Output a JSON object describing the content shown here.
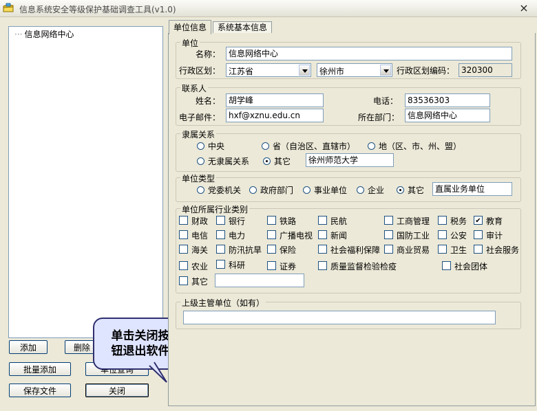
{
  "window": {
    "title": "信息系统安全等级保护基础调查工具(v1.0)",
    "close_symbol": "×"
  },
  "tree": {
    "items": [
      {
        "label": "信息网络中心"
      }
    ]
  },
  "left_buttons": {
    "add": "添加",
    "delete": "删除",
    "batch_add": "批量添加",
    "check": "单位查询",
    "save": "保存文件",
    "close": "关闭"
  },
  "callout": {
    "text": "单击关闭按\n钮退出软件"
  },
  "tabs": [
    {
      "label": "单位信息",
      "active": true
    },
    {
      "label": "系统基本信息",
      "active": false
    }
  ],
  "unit": {
    "title": "单位",
    "name_label": "名称：",
    "name_value": "信息网络中心",
    "region_label": "行政区划：",
    "province": "江苏省",
    "city": "徐州市",
    "code_label": "行政区划编码：",
    "code_value": "320300"
  },
  "contact": {
    "title": "联系人",
    "name_label": "姓名：",
    "name_value": "胡学峰",
    "phone_label": "电话：",
    "phone_value": "83536303",
    "email_label": "电子邮件：",
    "email_value": "hxf@xznu.edu.cn",
    "dept_label": "所在部门：",
    "dept_value": "信息网络中心"
  },
  "affiliation": {
    "title": "隶属关系",
    "options": [
      "中央",
      "省（自治区、直辖市）",
      "地（区、市、州、盟）",
      "无隶属关系",
      "其它"
    ],
    "selected": "其它",
    "other_value": "徐州师范大学"
  },
  "unit_type": {
    "title": "单位类型",
    "options": [
      "党委机关",
      "政府部门",
      "事业单位",
      "企业",
      "其它"
    ],
    "selected": "其它",
    "other_value": "直属业务单位"
  },
  "industry": {
    "title": "单位所属行业类别",
    "items": [
      {
        "label": "财政",
        "checked": false
      },
      {
        "label": "银行",
        "checked": false
      },
      {
        "label": "铁路",
        "checked": false
      },
      {
        "label": "民航",
        "checked": false
      },
      {
        "label": "工商管理",
        "checked": false
      },
      {
        "label": "税务",
        "checked": false
      },
      {
        "label": "教育",
        "checked": true
      },
      {
        "label": "电信",
        "checked": false
      },
      {
        "label": "电力",
        "checked": false
      },
      {
        "label": "广播电视",
        "checked": false
      },
      {
        "label": "新闻",
        "checked": false
      },
      {
        "label": "国防工业",
        "checked": false
      },
      {
        "label": "公安",
        "checked": false
      },
      {
        "label": "审计",
        "checked": false
      },
      {
        "label": "海关",
        "checked": false
      },
      {
        "label": "防汛抗旱",
        "checked": false
      },
      {
        "label": "保险",
        "checked": false
      },
      {
        "label": "社会福利保障",
        "checked": false
      },
      {
        "label": "商业贸易",
        "checked": false
      },
      {
        "label": "卫生",
        "checked": false
      },
      {
        "label": "社会服务",
        "checked": false
      },
      {
        "label": "农业",
        "checked": false
      },
      {
        "label": "科研",
        "checked": false
      },
      {
        "label": "证券",
        "checked": false
      },
      {
        "label": "质量监督检验检疫",
        "checked": false
      },
      {
        "label": "社会团体",
        "checked": false
      },
      {
        "label": "其它",
        "checked": false
      }
    ],
    "other_value": ""
  },
  "superior": {
    "title": "上级主管单位（如有）",
    "value": ""
  }
}
